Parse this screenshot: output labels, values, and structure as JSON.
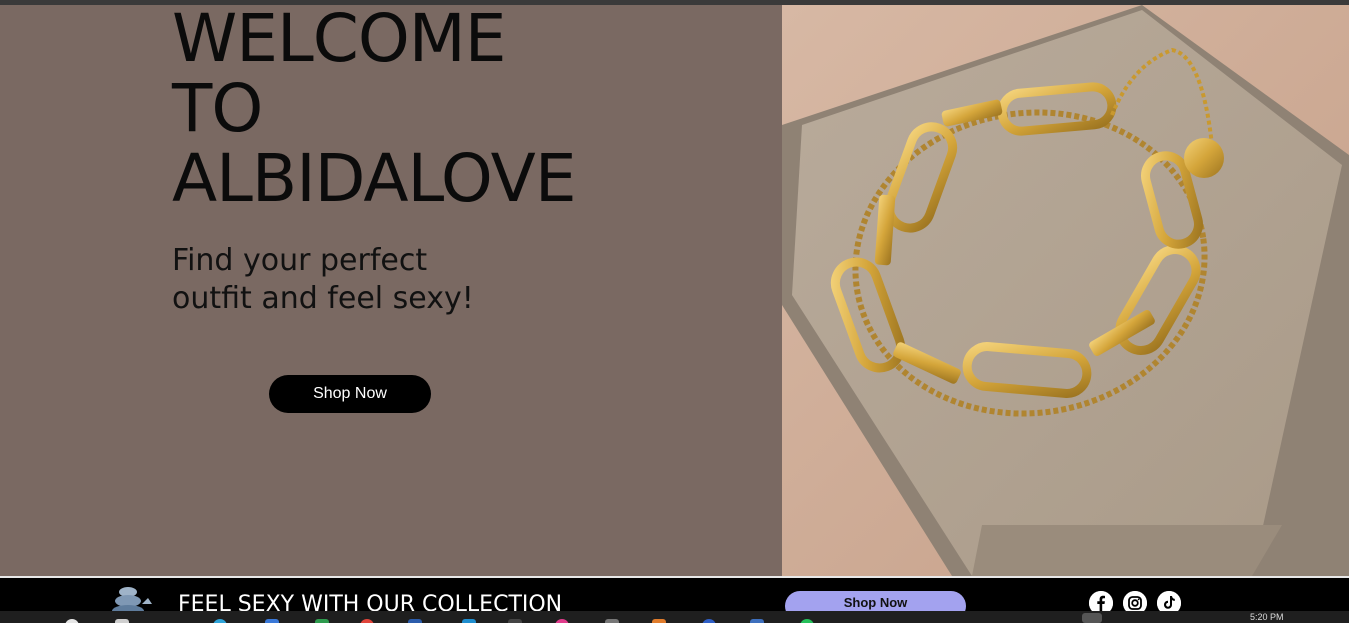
{
  "hero": {
    "title_lines": [
      "WELCOME",
      "TO",
      "ALBIDALOVE"
    ],
    "subtitle_lines": [
      "Find your perfect",
      "outfit and feel sexy!"
    ],
    "cta_label": "Shop Now"
  },
  "footer": {
    "tagline": "FEEL SEXY WITH OUR COLLECTION",
    "cta_label": "Shop Now",
    "social": [
      {
        "icon": "facebook-icon"
      },
      {
        "icon": "instagram-icon"
      },
      {
        "icon": "tiktok-icon"
      }
    ]
  },
  "taskbar": {
    "clock": "5:20 PM"
  },
  "colors": {
    "hero_bg": "#7a6962",
    "footer_bg": "#000000",
    "footer_button": "#a3a2ef",
    "gold": "#d4a53a"
  }
}
